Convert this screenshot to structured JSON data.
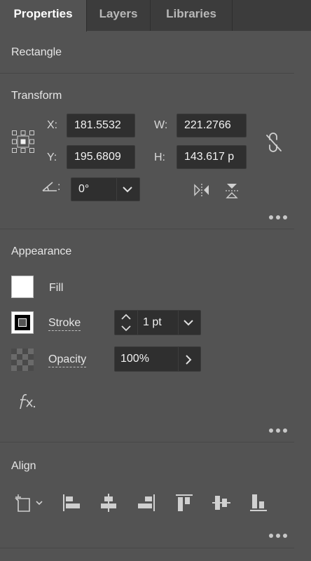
{
  "tabs": [
    {
      "label": "Properties",
      "active": true
    },
    {
      "label": "Layers",
      "active": false
    },
    {
      "label": "Libraries",
      "active": false
    }
  ],
  "object_type": "Rectangle",
  "transform": {
    "title": "Transform",
    "x_label": "X:",
    "x_value": "181.5532",
    "y_label": "Y:",
    "y_value": "195.6809",
    "w_label": "W:",
    "w_value": "221.2766",
    "h_label": "H:",
    "h_value": "143.617 p",
    "rotate_value": "0°"
  },
  "appearance": {
    "title": "Appearance",
    "fill_label": "Fill",
    "fill_color": "#ffffff",
    "stroke_label": "Stroke",
    "stroke_value": "1 pt",
    "opacity_label": "Opacity",
    "opacity_value": "100%"
  },
  "align": {
    "title": "Align"
  },
  "colors": {
    "panel_bg": "#535353",
    "tab_bar_bg": "#3c3c3c",
    "field_bg": "#2f2f2f"
  }
}
